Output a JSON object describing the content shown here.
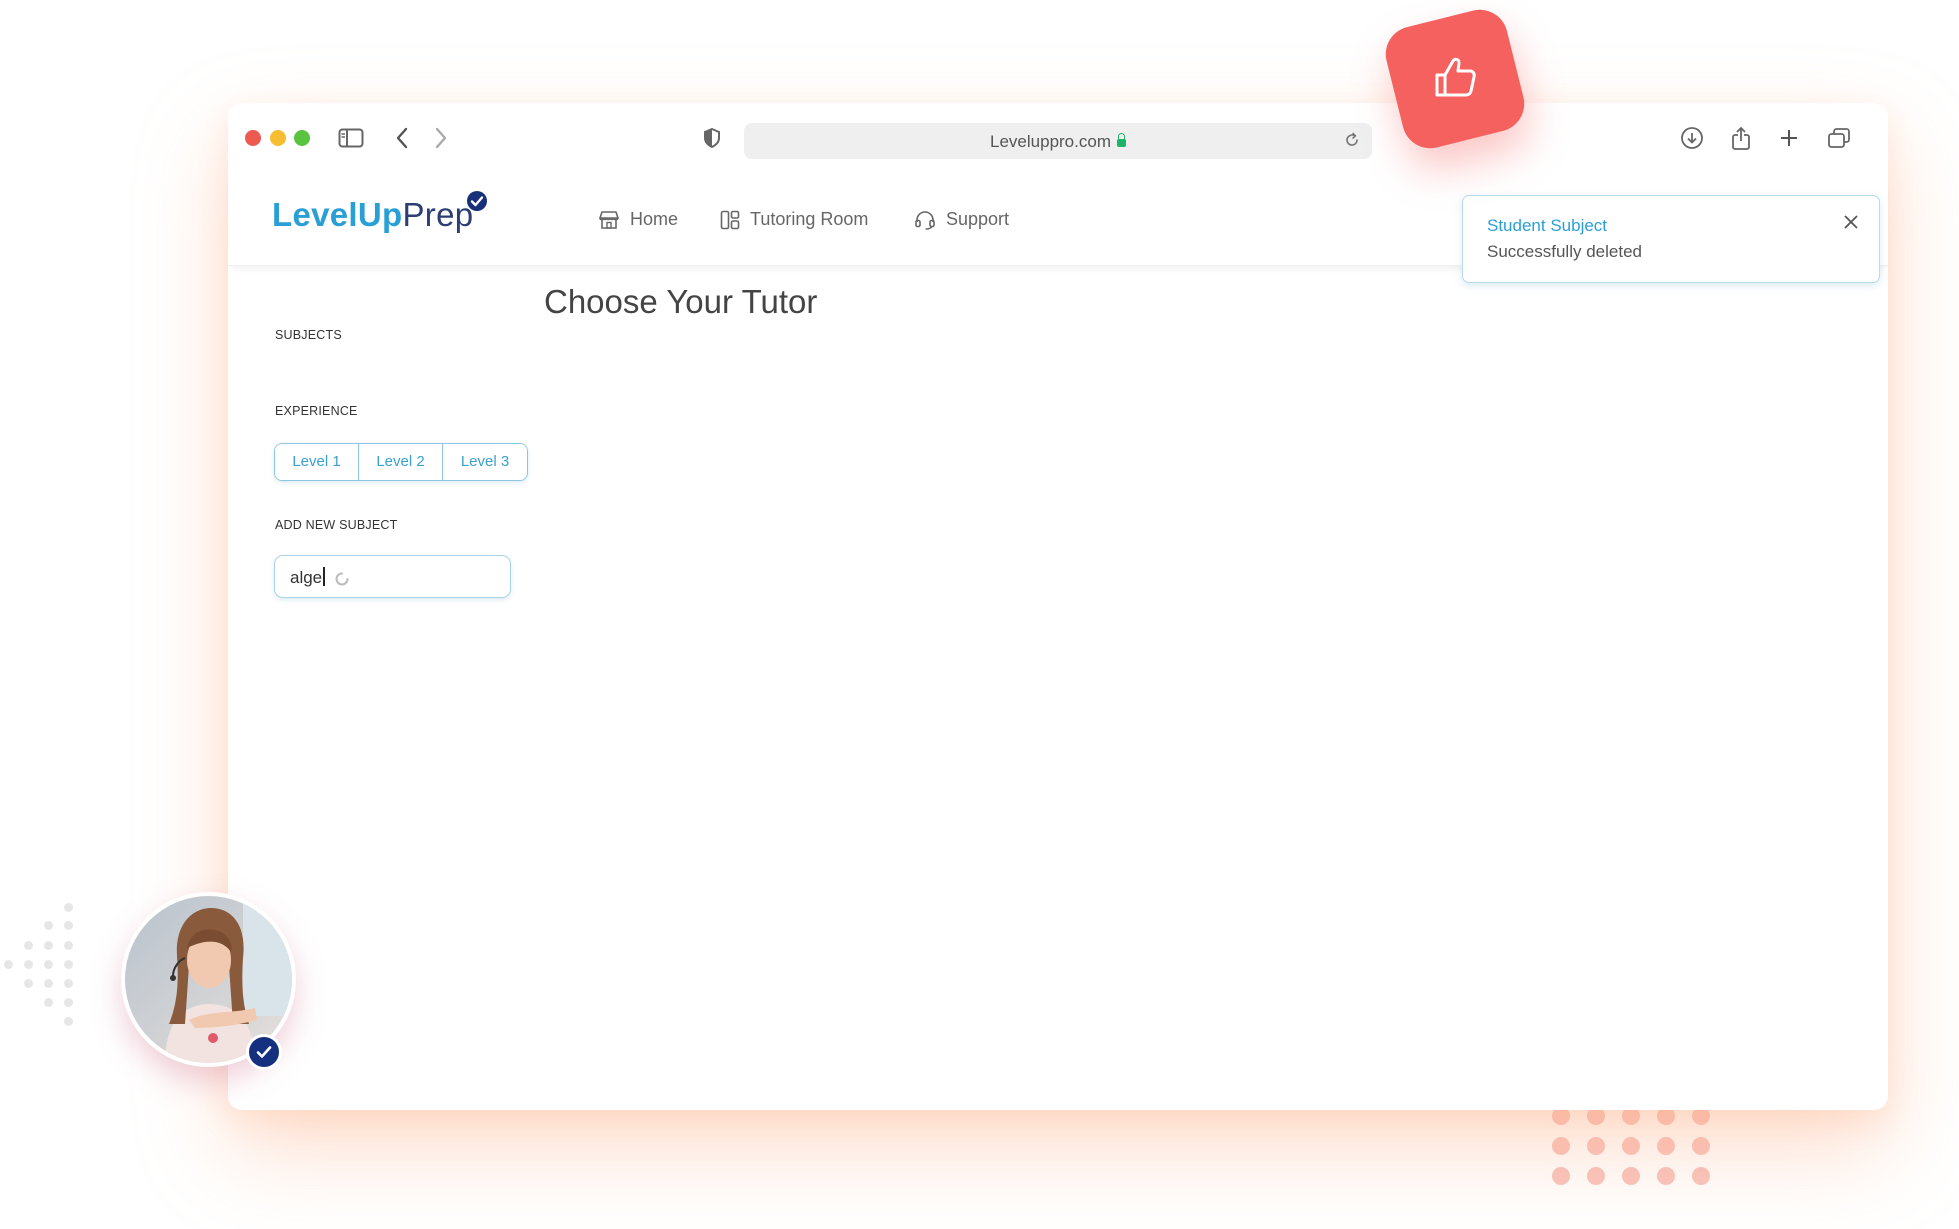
{
  "browser": {
    "url": "Leveluppro.com"
  },
  "brand": {
    "name_part1": "LevelUp",
    "name_part2": "Prep"
  },
  "nav": {
    "items": [
      {
        "label": "Home",
        "icon": "home-icon"
      },
      {
        "label": "Tutoring Room",
        "icon": "layout-icon"
      },
      {
        "label": "Support",
        "icon": "headset-icon"
      }
    ]
  },
  "page": {
    "title": "Choose Your Tutor",
    "subjects_label": "SUBJECTS",
    "experience_label": "EXPERIENCE",
    "levels": [
      "Level 1",
      "Level 2",
      "Level 3"
    ],
    "add_subject_label": "ADD NEW SUBJECT",
    "add_subject_value": "alge"
  },
  "toast": {
    "title": "Student Subject",
    "message": "Successfully deleted"
  },
  "colors": {
    "accent": "#2a9fd6",
    "brand_dark": "#2c3e73",
    "like_badge": "#f4615f",
    "border_light": "#8ec6df"
  }
}
